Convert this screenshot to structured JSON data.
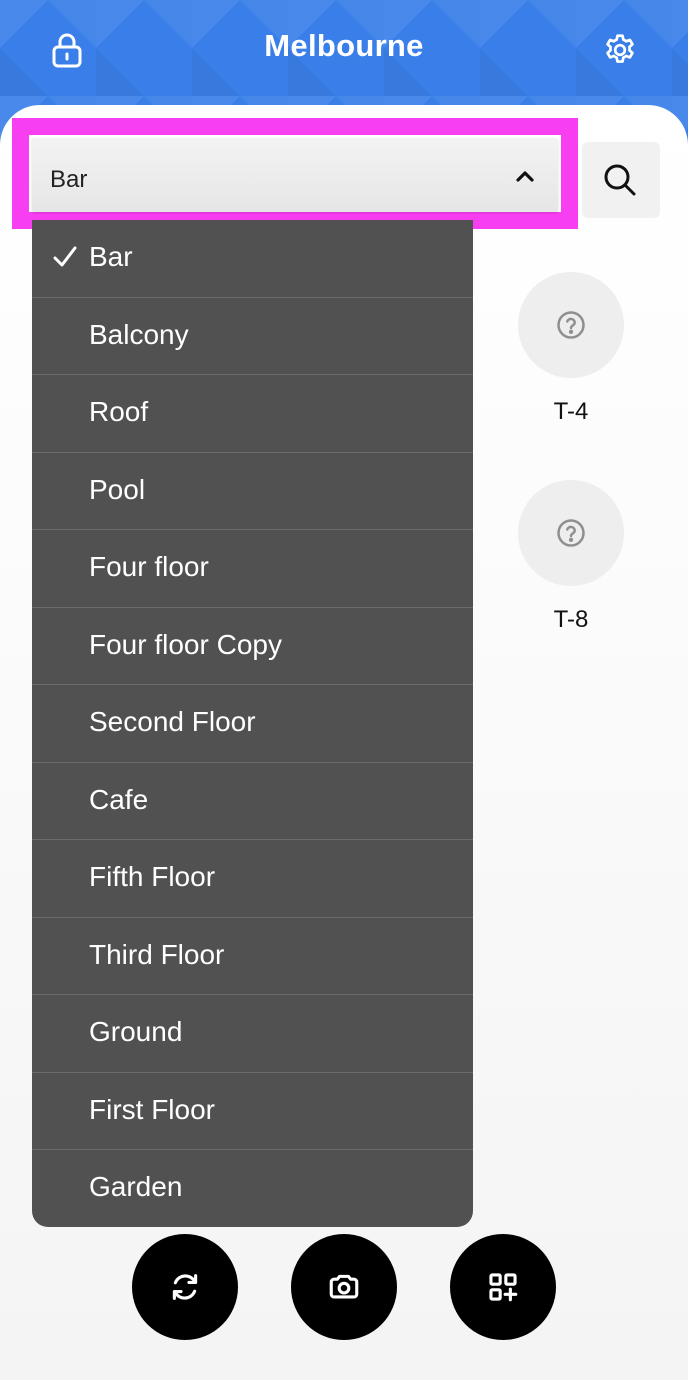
{
  "header": {
    "title": "Melbourne",
    "left_icon": "lock-icon",
    "right_icon": "gear-icon"
  },
  "area_selector": {
    "selected": "Bar",
    "icon": "chevron-up-icon"
  },
  "search": {
    "icon": "search-icon"
  },
  "tables": [
    {
      "label": "T-4",
      "icon": "question-icon"
    },
    {
      "label": "T-8",
      "icon": "question-icon"
    }
  ],
  "dropdown": {
    "items": [
      {
        "label": "Bar",
        "selected": true
      },
      {
        "label": "Balcony",
        "selected": false
      },
      {
        "label": "Roof",
        "selected": false
      },
      {
        "label": "Pool",
        "selected": false
      },
      {
        "label": "Four floor",
        "selected": false
      },
      {
        "label": "Four floor Copy",
        "selected": false
      },
      {
        "label": "Second Floor",
        "selected": false
      },
      {
        "label": "Cafe",
        "selected": false
      },
      {
        "label": "Fifth Floor",
        "selected": false
      },
      {
        "label": "Third Floor",
        "selected": false
      },
      {
        "label": "Ground",
        "selected": false
      },
      {
        "label": "First Floor",
        "selected": false
      },
      {
        "label": "Garden",
        "selected": false
      }
    ]
  },
  "actions": [
    {
      "icon": "refresh-icon"
    },
    {
      "icon": "camera-icon"
    },
    {
      "icon": "qr-add-icon"
    }
  ],
  "colors": {
    "header_blue": "#3a7fe9",
    "highlight_magenta": "#f73ef0",
    "dropdown_bg": "#515151",
    "fab_bg": "#000000"
  }
}
